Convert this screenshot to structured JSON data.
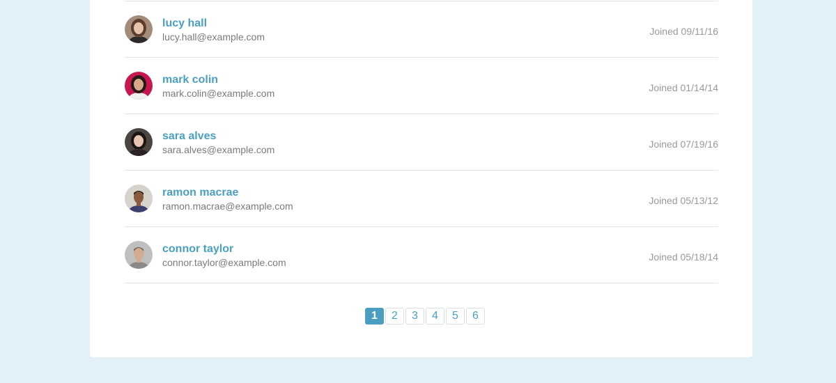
{
  "users": [
    {
      "name": "lucy hall",
      "email": "lucy.hall@example.com",
      "joined": "Joined 09/11/16",
      "avatar": "woman-portrait-avatar",
      "avatar_bg": "#a48c7c",
      "avatar_hair": "#5a3d2b",
      "avatar_skin": "#e7c3ae",
      "avatar_shirt": "#2f2a2a"
    },
    {
      "name": "mark colin",
      "email": "mark.colin@example.com",
      "joined": "Joined 01/14/14",
      "avatar": "woman-portrait-avatar",
      "avatar_bg": "#c8174f",
      "avatar_hair": "#241a17",
      "avatar_skin": "#d9a98c",
      "avatar_shirt": "#f0f0f0"
    },
    {
      "name": "sara alves",
      "email": "sara.alves@example.com",
      "joined": "Joined 07/19/16",
      "avatar": "woman-portrait-avatar",
      "avatar_bg": "#4a4540",
      "avatar_hair": "#1d1512",
      "avatar_skin": "#e8c4b4",
      "avatar_shirt": "#2b2323"
    },
    {
      "name": "ramon macrae",
      "email": "ramon.macrae@example.com",
      "joined": "Joined 05/13/12",
      "avatar": "man-portrait-avatar",
      "avatar_bg": "#d6d2cc",
      "avatar_hair": "#1f1a18",
      "avatar_skin": "#8a5a3f",
      "avatar_shirt": "#3a3f6e"
    },
    {
      "name": "connor taylor",
      "email": "connor.taylor@example.com",
      "joined": "Joined 05/18/14",
      "avatar": "man-portrait-avatar",
      "avatar_bg": "#bfbfbf",
      "avatar_hair": "#6a5a4e",
      "avatar_skin": "#d2ab90",
      "avatar_shirt": "#8a8a88"
    }
  ],
  "pagination": {
    "pages": [
      "1",
      "2",
      "3",
      "4",
      "5",
      "6"
    ],
    "active": "1"
  },
  "colors": {
    "page_bg": "#e2f1f7",
    "panel_bg": "#ffffff",
    "accent": "#4a9fc1",
    "email_text": "#7a7a7a",
    "joined_text": "#999999",
    "divider": "#e4e4e4"
  }
}
